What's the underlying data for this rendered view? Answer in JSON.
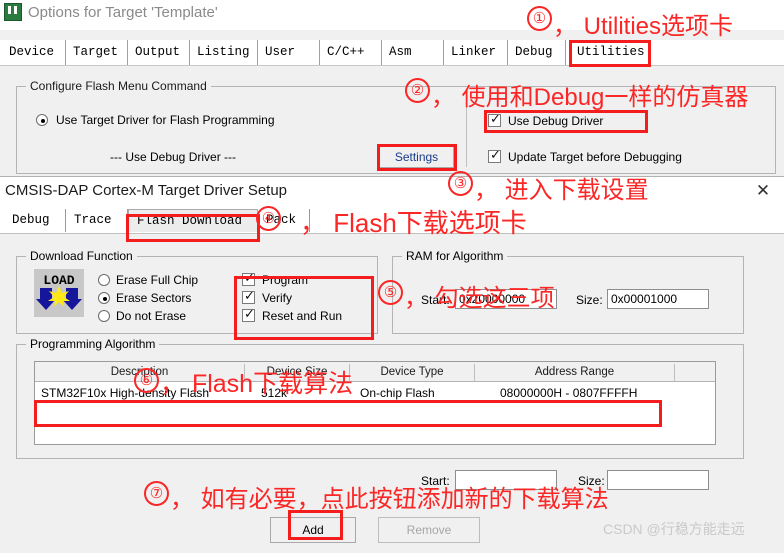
{
  "outer_dialog": {
    "title": "Options for Target 'Template'",
    "icon": "keil-uvision-icon",
    "tabs": [
      {
        "label": "Device",
        "selected": false
      },
      {
        "label": "Target",
        "selected": false
      },
      {
        "label": "Output",
        "selected": false
      },
      {
        "label": "Listing",
        "selected": false
      },
      {
        "label": "User",
        "selected": false
      },
      {
        "label": "C/C++",
        "selected": false
      },
      {
        "label": "Asm",
        "selected": false
      },
      {
        "label": "Linker",
        "selected": false
      },
      {
        "label": "Debug",
        "selected": false
      },
      {
        "label": "Utilities",
        "selected": true
      }
    ],
    "configure_group": {
      "legend": "Configure Flash Menu Command",
      "radio_use_target_driver": "Use Target Driver for Flash Programming",
      "driver_name": "--- Use Debug Driver ---",
      "settings_button": "Settings",
      "checkbox_use_debug_driver": "Use Debug Driver",
      "checkbox_update_target": "Update Target before Debugging"
    }
  },
  "inner_dialog": {
    "title": "CMSIS-DAP Cortex-M Target Driver Setup",
    "close_glyph": "✕",
    "tabs": [
      {
        "label": "Debug",
        "selected": false
      },
      {
        "label": "Trace",
        "selected": false
      },
      {
        "label": "Flash Download",
        "selected": true
      },
      {
        "label": "Pack",
        "selected": false
      }
    ],
    "download_function": {
      "legend": "Download Function",
      "icon_label": "LOAD",
      "radios": [
        {
          "label": "Erase Full Chip",
          "checked": false
        },
        {
          "label": "Erase Sectors",
          "checked": true
        },
        {
          "label": "Do not Erase",
          "checked": false
        }
      ],
      "checkboxes": [
        {
          "label": "Program",
          "checked": true
        },
        {
          "label": "Verify",
          "checked": true
        },
        {
          "label": "Reset and Run",
          "checked": true
        }
      ]
    },
    "ram_for_algorithm": {
      "legend": "RAM for Algorithm",
      "start_label": "Start:",
      "start_value": "0x20000000",
      "size_label": "Size:",
      "size_value": "0x00001000"
    },
    "programming_algorithm": {
      "legend": "Programming Algorithm",
      "columns": [
        "Description",
        "Device Size",
        "Device Type",
        "Address Range"
      ],
      "rows": [
        {
          "description": "STM32F10x High-density Flash",
          "device_size": "512k",
          "device_type": "On-chip Flash",
          "address_range": "08000000H - 0807FFFFH"
        }
      ],
      "start_label": "Start:",
      "start_value": "",
      "size_label": "Size:",
      "size_value": "",
      "add_button": "Add",
      "remove_button": "Remove"
    }
  },
  "annotations": [
    {
      "num": "①",
      "text": "， Utilities选项卡"
    },
    {
      "num": "②",
      "text": "， 使用和Debug一样的仿真器"
    },
    {
      "num": "③",
      "text": "， 进入下载设置"
    },
    {
      "num": "④",
      "text": "， Flash下载选项卡"
    },
    {
      "num": "⑤",
      "text": "， 勾选这三项"
    },
    {
      "num": "⑥",
      "text": "， Flash下载算法"
    },
    {
      "num": "⑦",
      "text": "， 如有必要，点此按钮添加新的下载算法"
    }
  ],
  "watermark": "CSDN @行稳方能走远",
  "colors": {
    "annotation_red": "#fb2626",
    "dialog_bg": "#f0f0f0",
    "titlebar_bg": "#ffffff"
  }
}
